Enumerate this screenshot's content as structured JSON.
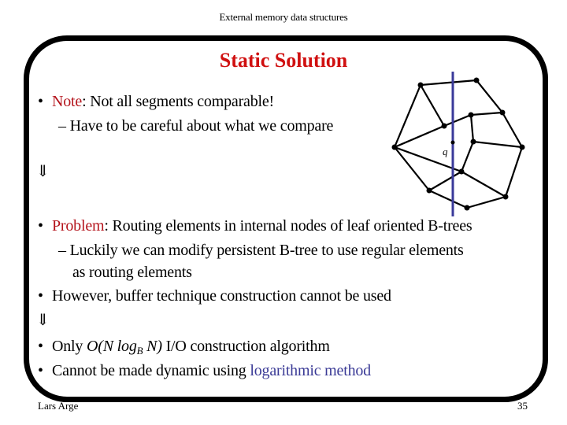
{
  "header": {
    "text": "External memory data structures"
  },
  "slide": {
    "title": "Static Solution",
    "lines": [
      {
        "type": "bullet",
        "label": "Note",
        "text": ": Not all segments comparable!"
      },
      {
        "type": "sub",
        "text": "– Have to be careful about what we compare"
      },
      {
        "type": "arrow",
        "text": "⇓"
      },
      {
        "type": "bullet",
        "label": "Problem",
        "text": ": Routing elements in internal nodes of leaf oriented B-trees"
      },
      {
        "type": "sub",
        "text": "– Luckily we can modify persistent B-tree to use regular elements"
      },
      {
        "type": "sub-cont",
        "text": "as routing elements"
      },
      {
        "type": "bullet",
        "text": "However, buffer technique construction cannot be used"
      },
      {
        "type": "arrow",
        "text": "⇓"
      },
      {
        "type": "bullet",
        "prefix": "Only ",
        "math": {
          "main": "O(N log",
          "sub": "B",
          "tail": " N)"
        },
        "text": " I/O construction algorithm"
      },
      {
        "type": "bullet",
        "prefix": "Cannot be made dynamic using ",
        "link": "logarithmic method"
      }
    ],
    "bullet_char": "•"
  },
  "diagram": {
    "query_label": "q",
    "colors": {
      "edges": "#000000",
      "query_line": "#3a3a9a"
    }
  },
  "footer": {
    "author": "Lars Arge",
    "page": "35"
  },
  "colors": {
    "title": "#d01010",
    "keyword": "#b4141c",
    "link": "#3a3a96",
    "frame": "#000000"
  }
}
